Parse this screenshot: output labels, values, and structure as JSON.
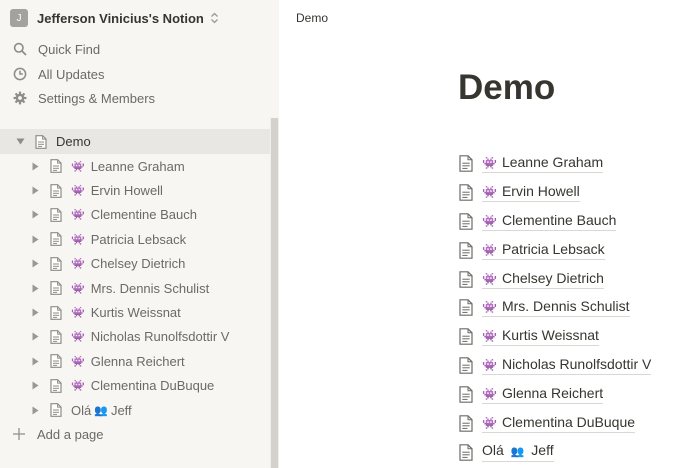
{
  "workspace": {
    "initial": "J",
    "name": "Jefferson Vinicius's Notion"
  },
  "nav": {
    "quick_find": "Quick Find",
    "all_updates": "All Updates",
    "settings": "Settings & Members"
  },
  "tree": {
    "root": "Demo",
    "items": [
      "Leanne Graham",
      "Ervin Howell",
      "Clementine Bauch",
      "Patricia Lebsack",
      "Chelsey Dietrich",
      "Mrs. Dennis Schulist",
      "Kurtis Weissnat",
      "Nicholas Runolfsdottir V",
      "Glenna Reichert",
      "Clementina DuBuque"
    ],
    "last": {
      "prefix": "Olá",
      "suffix": "Jeff"
    },
    "add_page": "Add a page"
  },
  "main": {
    "breadcrumb": "Demo",
    "title": "Demo",
    "links": [
      "Leanne Graham",
      "Ervin Howell",
      "Clementine Bauch",
      "Patricia Lebsack",
      "Chelsey Dietrich",
      "Mrs. Dennis Schulist",
      "Kurtis Weissnat",
      "Nicholas Runolfsdottir V",
      "Glenna Reichert",
      "Clementina DuBuque"
    ],
    "last_link": {
      "prefix": "Olá",
      "suffix": "Jeff"
    }
  },
  "icons": {
    "page_emoji": "alien-monster-icon",
    "people_emoji": "busts-in-silhouette-icon",
    "page": "page-icon"
  }
}
